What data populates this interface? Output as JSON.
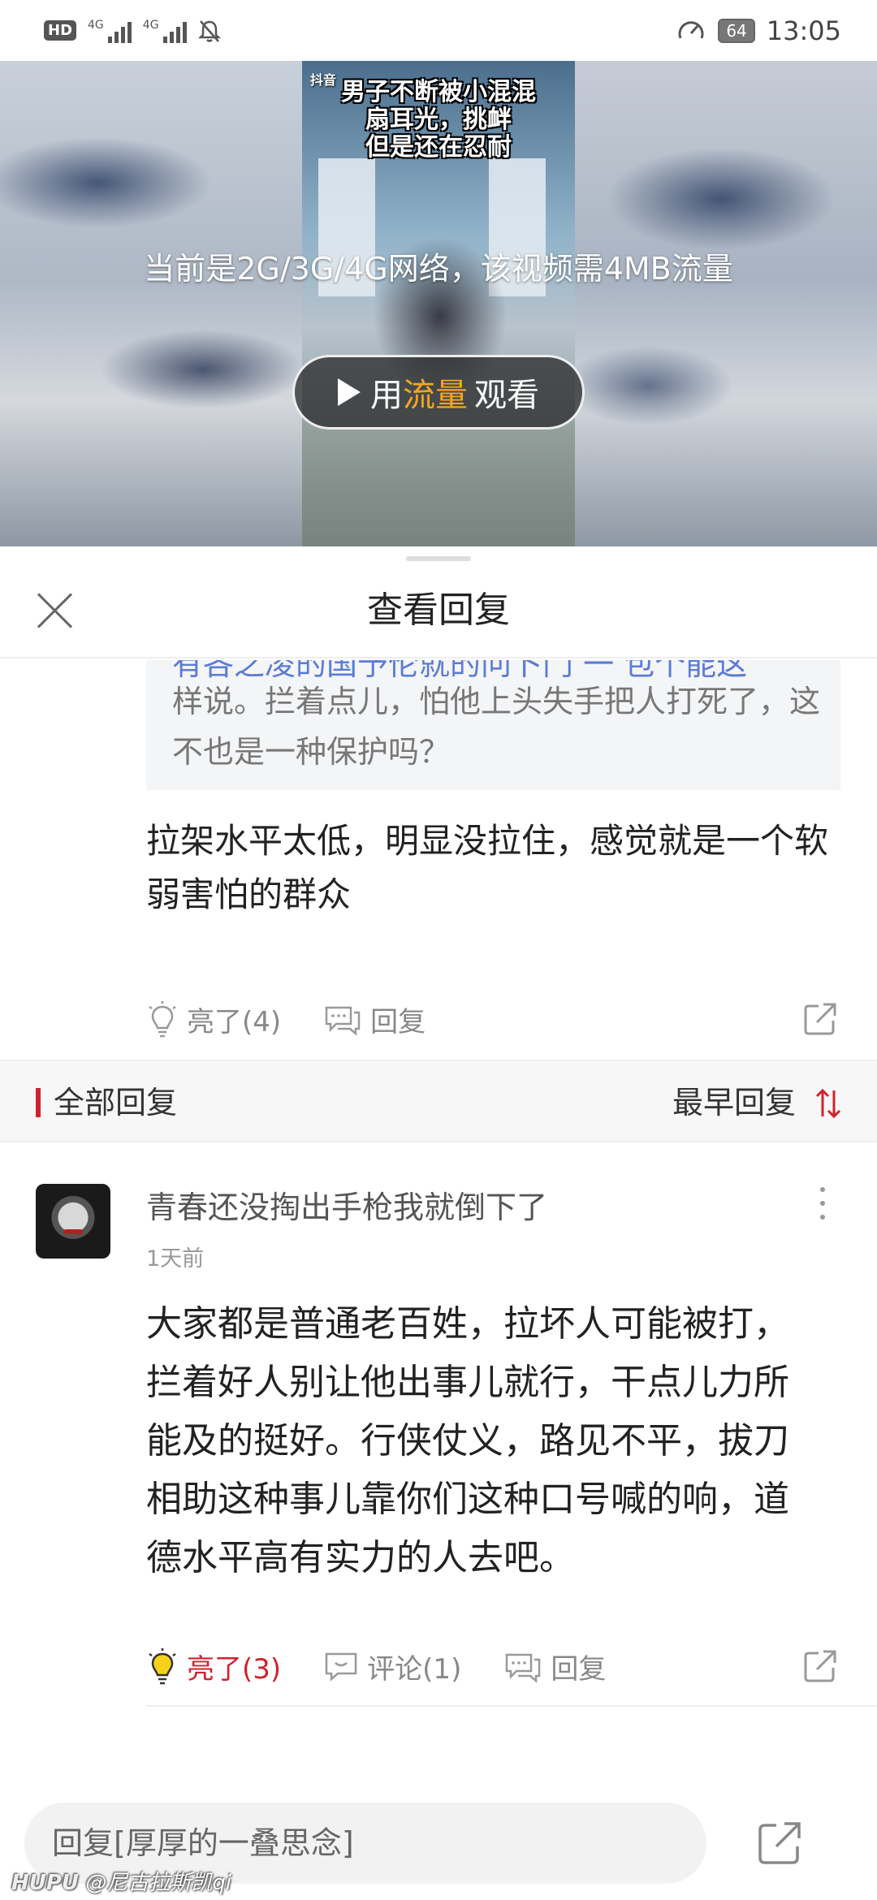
{
  "status_bar": {
    "hd": "HD",
    "net1": "4G",
    "net2": "4G",
    "battery": "64",
    "time": "13:05"
  },
  "video": {
    "source_tag": "抖音",
    "caption_lines": [
      "男子不断被小混混",
      "扇耳光，挑衅",
      "但是还在忍耐"
    ],
    "network_notice": "当前是2G/3G/4G网络，该视频需4MB流量",
    "play_prefix": "用",
    "play_accent": "流量",
    "play_suffix": "观看",
    "accent_color": "#f5a623"
  },
  "sheet": {
    "title": "查看回复"
  },
  "quote": {
    "cut_line": "有各之凌的国予伦就的问卜门 一 包个能这",
    "text": "样说。拦着点儿，怕他上头失手把人打死了，这不也是一种保护吗？"
  },
  "main_reply": {
    "text": "拉架水平太低，明显没拉住，感觉就是一个软弱害怕的群众",
    "like_label": "亮了(4)",
    "reply_label": "回复"
  },
  "section": {
    "label": "全部回复",
    "sort_label": "最早回复",
    "accent": "#d0232f"
  },
  "comment": {
    "user": "青春还没掏出手枪我就倒下了",
    "time": "1天前",
    "text": "大家都是普通老百姓，拉坏人可能被打，拦着好人别让他出事儿就行，干点儿力所能及的挺好。行侠仗义，路见不平，拔刀相助这种事儿靠你们这种口号喊的响，道德水平高有实力的人去吧。",
    "like_label": "亮了(3)",
    "comment_label": "评论(1)",
    "reply_label": "回复"
  },
  "bottom": {
    "input_placeholder": "回复[厚厚的一叠思念]",
    "watermark_brand": "HUPU",
    "watermark_user": "@尼古拉斯凯qi"
  }
}
